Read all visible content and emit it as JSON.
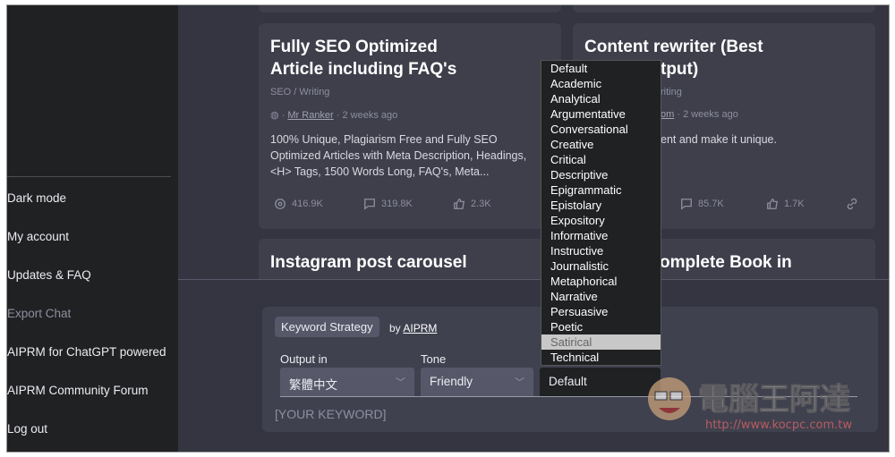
{
  "sidebar": {
    "items": [
      {
        "label": "Dark mode"
      },
      {
        "label": "My account"
      },
      {
        "label": "Updates & FAQ"
      },
      {
        "label": "Export Chat",
        "disabled": true
      },
      {
        "label": "AIPRM for ChatGPT powered"
      },
      {
        "label": "AIPRM Community Forum"
      },
      {
        "label": "Log out"
      }
    ]
  },
  "cards": [
    {
      "title1": "Fully SEO Optimized",
      "title2": "Article including FAQ's",
      "category": "SEO / Writing",
      "author": "Mr Ranker",
      "time": "· 2 weeks ago",
      "desc": [
        "100% Unique, Plagiarism Free and Fully SEO",
        "Optimized Articles with Meta Description, Headings,",
        "<H> Tags, 1500 Words Long, FAQ's, Meta..."
      ],
      "views": "416.9K",
      "comments": "319.8K",
      "likes": "2.3K"
    },
    {
      "title1": "Content rewriter (Best",
      "title2": "tput)",
      "category": "riting",
      "author": "om",
      "time": "· 2 weeks ago",
      "desc": "ent and make it unique.",
      "comments": "85.7K",
      "likes": "1.7K"
    },
    {
      "title": "Instagram post carousel"
    },
    {
      "title": "omplete Book in"
    }
  ],
  "prompt": {
    "tag": "Keyword Strategy",
    "by": "by",
    "author": "AIPRM",
    "output_label": "Output in",
    "output_value": "繁體中文",
    "tone_label": "Tone",
    "tone_value": "Friendly",
    "style_value": "Default",
    "keyword_placeholder": "[YOUR KEYWORD]"
  },
  "dropdown": {
    "options": [
      "Default",
      "Academic",
      "Analytical",
      "Argumentative",
      "Conversational",
      "Creative",
      "Critical",
      "Descriptive",
      "Epigrammatic",
      "Epistolary",
      "Expository",
      "Informative",
      "Instructive",
      "Journalistic",
      "Metaphorical",
      "Narrative",
      "Persuasive",
      "Poetic",
      "Satirical",
      "Technical"
    ],
    "highlighted": "Satirical"
  },
  "watermark": {
    "text": "電腦王阿達",
    "url": "http://www.kocpc.com.tw"
  }
}
